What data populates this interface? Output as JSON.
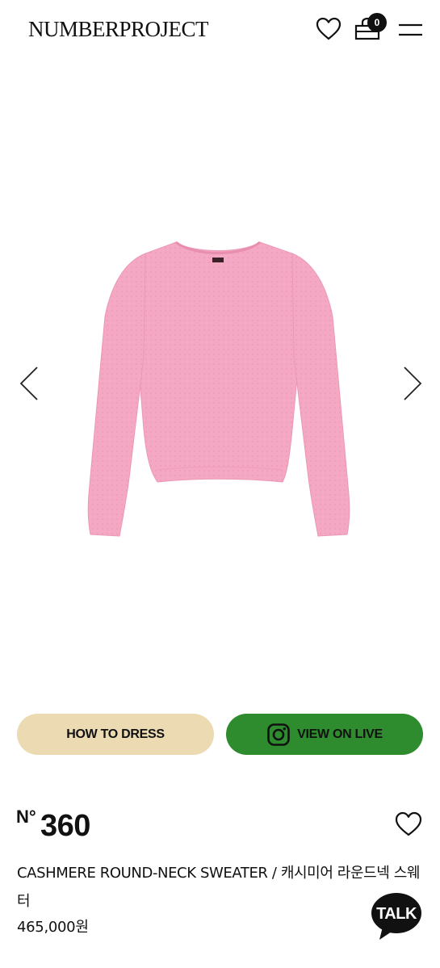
{
  "header": {
    "logo": "NUMBERPROJECT",
    "cart_count": "0"
  },
  "icons": [
    "heart-icon",
    "shopping-bag-icon",
    "menu-icon",
    "chevron-left-icon",
    "chevron-right-icon",
    "instagram-icon",
    "kakao-talk-icon"
  ],
  "product": {
    "image_color": "#f4a8c4",
    "number_prefix": "N°",
    "number": "360",
    "name": "CASHMERE ROUND-NECK SWEATER / 캐시미어 라운드넥 스웨터",
    "price": "465,000원"
  },
  "buttons": {
    "how_to_dress": "HOW TO DRESS",
    "view_on_live": "VIEW ON LIVE"
  },
  "talk_label": "TALK",
  "colors": {
    "how_to_dress_bg": "#ecdab2",
    "view_on_live_bg": "#2e8b2e",
    "text": "#111111"
  }
}
